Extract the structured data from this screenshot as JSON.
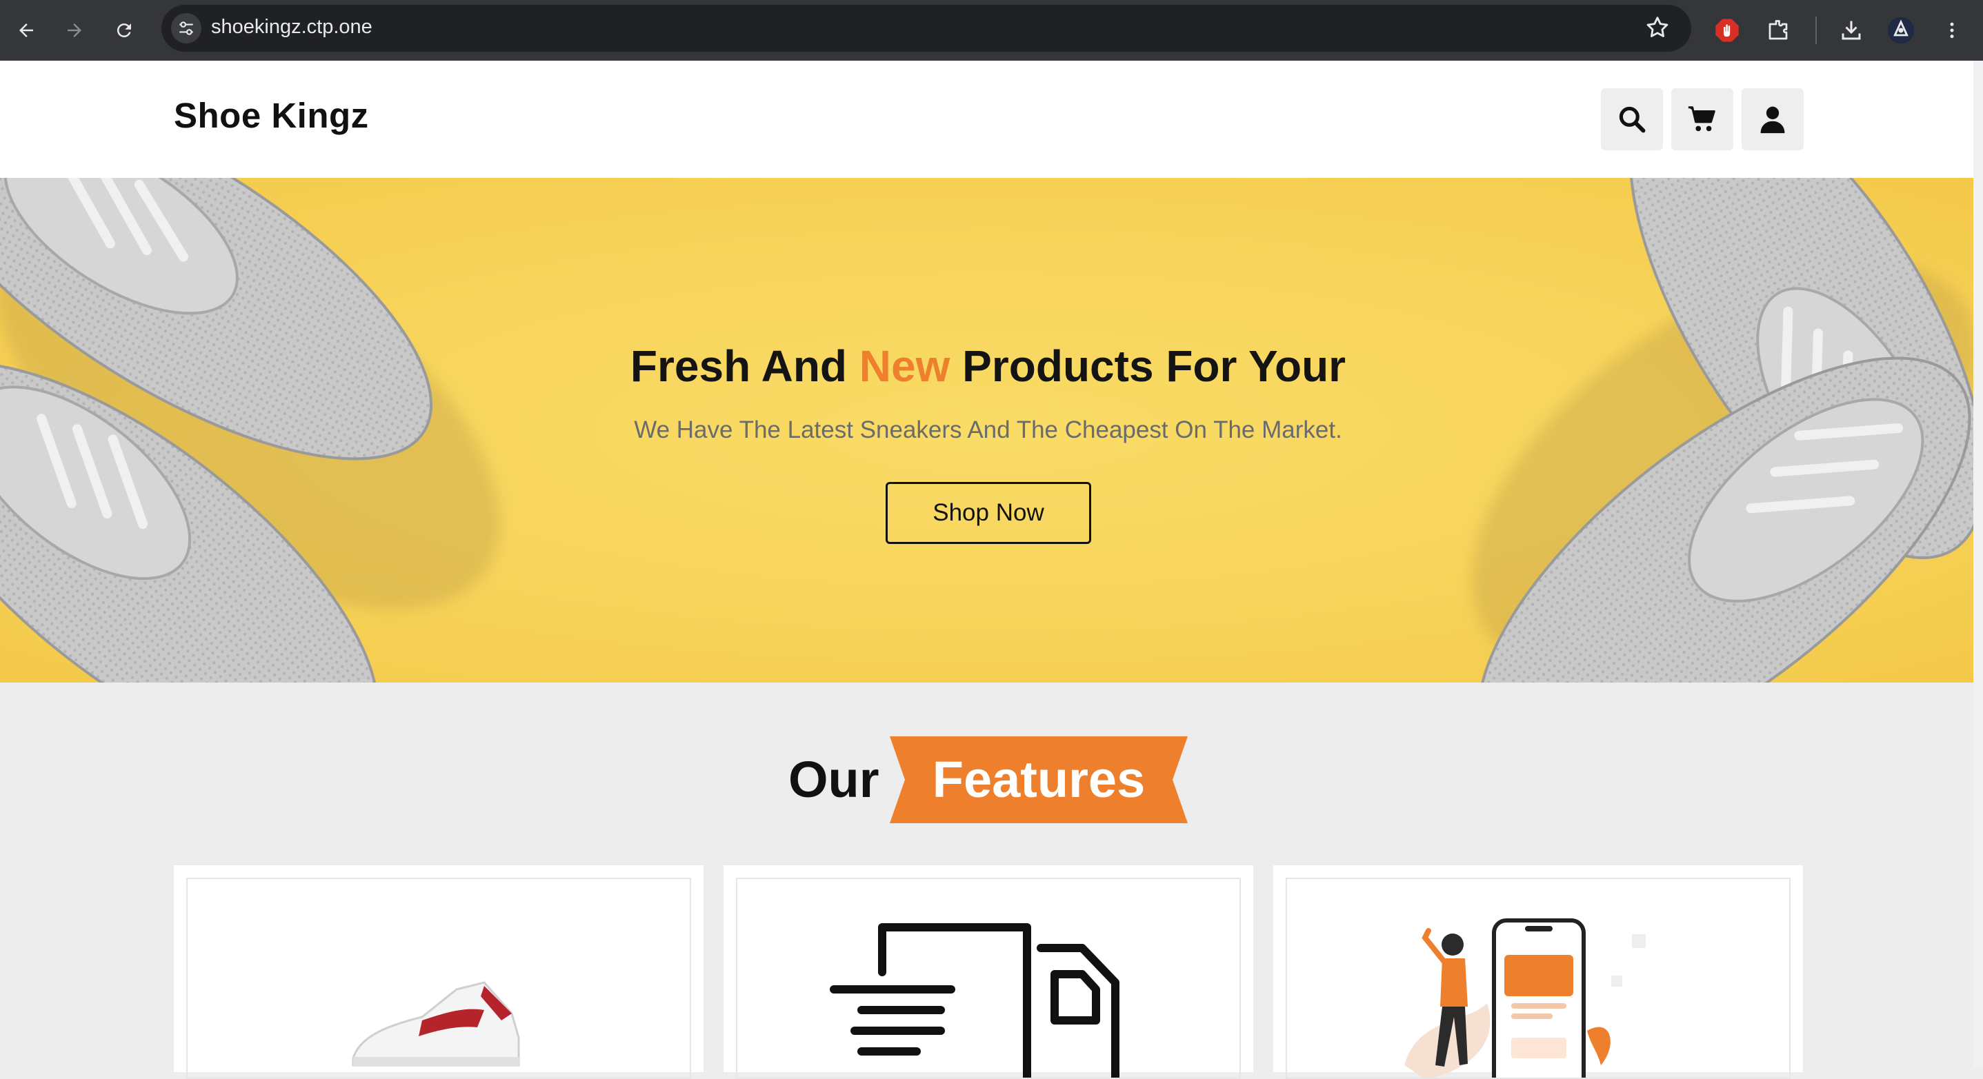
{
  "browser": {
    "url": "shoekingz.ctp.one"
  },
  "site": {
    "logo": "Shoe Kingz",
    "header_icons": [
      "search-icon",
      "cart-icon",
      "user-icon"
    ]
  },
  "hero": {
    "title_before": "Fresh And ",
    "title_accent": "New",
    "title_after": " Products For Your",
    "subtitle": "We Have The Latest Sneakers And The Cheapest On The Market.",
    "cta_label": "Shop Now"
  },
  "features": {
    "heading_plain": "Our",
    "heading_highlight": "Features",
    "cards": [
      {
        "image": "sneaker-image"
      },
      {
        "image": "fast-delivery-icon"
      },
      {
        "image": "mobile-payment-illustration"
      }
    ]
  },
  "colors": {
    "accent": "#ee7f2d",
    "hero_bg": "#f7d35a",
    "chrome": "#35363a"
  }
}
